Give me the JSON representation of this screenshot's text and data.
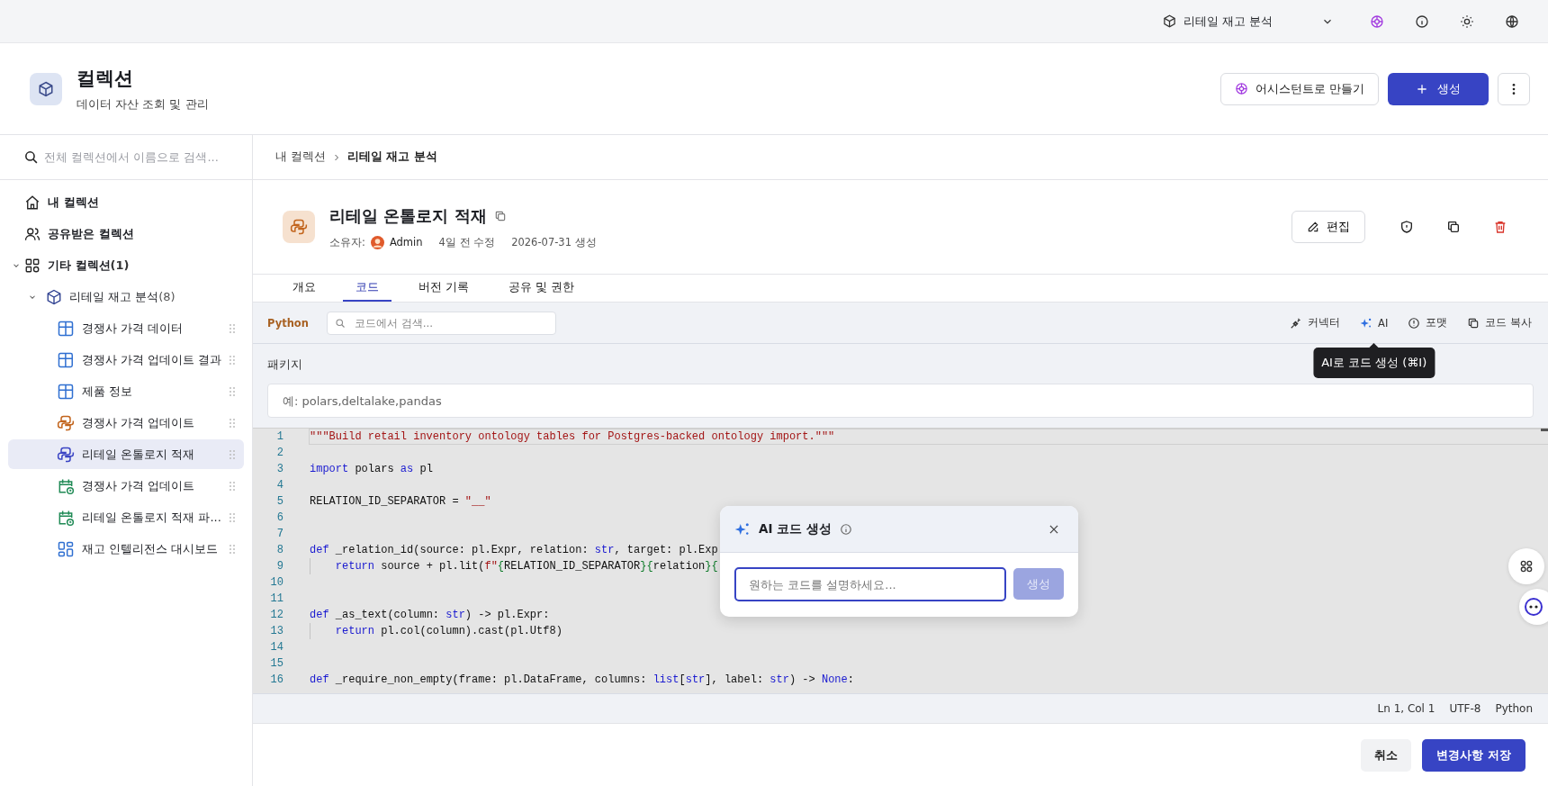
{
  "top_bar": {
    "project": "리테일 재고 분석"
  },
  "header": {
    "title": "컬렉션",
    "subtitle": "데이터 자산 조회 및 관리",
    "assistant_button": "어시스턴트로 만들기",
    "create_button": "생성"
  },
  "sidebar": {
    "search_placeholder": "전체 컬렉션에서 이름으로 검색...",
    "items": [
      {
        "label": "내 컬렉션",
        "kind": "home",
        "selected": false
      },
      {
        "label": "공유받은 컬렉션",
        "kind": "shared",
        "selected": false
      },
      {
        "label": "기타 컬렉션",
        "count": "(1)",
        "kind": "group",
        "selected": false,
        "expanded": true,
        "children": [
          {
            "label": "리테일 재고 분석",
            "count": "(8)",
            "kind": "collection",
            "selected": false,
            "expanded": true,
            "children": [
              {
                "label": "경쟁사 가격 데이터",
                "kind": "table",
                "selected": false
              },
              {
                "label": "경쟁사 가격 업데이트 결과",
                "kind": "table",
                "selected": false
              },
              {
                "label": "제품 정보",
                "kind": "table",
                "selected": false
              },
              {
                "label": "경쟁사 가격 업데이트",
                "kind": "python",
                "selected": false
              },
              {
                "label": "리테일 온톨로지 적재",
                "kind": "python",
                "selected": true
              },
              {
                "label": "경쟁사 가격 업데이트",
                "kind": "schedule",
                "selected": false
              },
              {
                "label": "리테일 온톨로지 적재 파...",
                "kind": "schedule",
                "selected": false
              },
              {
                "label": "재고 인텔리전스 대시보드",
                "kind": "dashboard",
                "selected": false
              }
            ]
          }
        ]
      }
    ]
  },
  "breadcrumb": [
    "내 컬렉션",
    "리테일 재고 분석"
  ],
  "detail": {
    "title": "리테일 온톨로지 적재",
    "owner_label": "소유자:",
    "owner": "Admin",
    "modified": "4일 전 수정",
    "created": "2026-07-31 생성",
    "edit_button": "편집"
  },
  "tabs": [
    {
      "label": "개요",
      "selected": false
    },
    {
      "label": "코드",
      "selected": true
    },
    {
      "label": "버전 기록",
      "selected": false
    },
    {
      "label": "공유 및 권한",
      "selected": false
    }
  ],
  "toolbar": {
    "language": "Python",
    "search_placeholder": "코드에서 검색...",
    "actions": [
      {
        "label": "커넥터",
        "kind": "connector"
      },
      {
        "label": "AI",
        "kind": "ai"
      },
      {
        "label": "포맷",
        "kind": "format"
      },
      {
        "label": "코드 복사",
        "kind": "copy"
      }
    ],
    "tooltip": "AI로 코드 생성 (⌘I)"
  },
  "packages": {
    "label": "패키지",
    "placeholder": "예: polars,deltalake,pandas"
  },
  "editor": {
    "lines": [
      {
        "number": "1",
        "current": true,
        "tokens": [
          {
            "text": "\"\"\"Build retail inventory ontology tables for Postgres-backed ontology import.\"\"\"",
            "kind": "string"
          }
        ]
      },
      {
        "number": "2",
        "current": false
      },
      {
        "number": "3",
        "current": false,
        "tokens": [
          {
            "text": "import",
            "kind": "keyword"
          },
          {
            "text": " polars ",
            "kind": "plain"
          },
          {
            "text": "as",
            "kind": "keyword"
          },
          {
            "text": " pl",
            "kind": "plain"
          }
        ]
      },
      {
        "number": "4",
        "current": false
      },
      {
        "number": "5",
        "current": false,
        "tokens": [
          {
            "text": "RELATION_ID_SEPARATOR = ",
            "kind": "plain"
          },
          {
            "text": "\"__\"",
            "kind": "string"
          }
        ]
      },
      {
        "number": "6",
        "current": false
      },
      {
        "number": "7",
        "current": false
      },
      {
        "number": "8",
        "current": false,
        "tokens": [
          {
            "text": "def",
            "kind": "keyword"
          },
          {
            "text": " _relation_id(source: pl.Expr, relation: ",
            "kind": "plain"
          },
          {
            "text": "str",
            "kind": "keyword"
          },
          {
            "text": ", target: pl.Exp",
            "kind": "plain"
          }
        ]
      },
      {
        "number": "9",
        "current": false,
        "indented": true,
        "tokens": [
          {
            "text": "return",
            "kind": "keyword"
          },
          {
            "text": " source + pl.lit(",
            "kind": "plain"
          },
          {
            "text": "f\"",
            "kind": "string"
          },
          {
            "text": "{",
            "kind": "interp"
          },
          {
            "text": "RELATION_ID_SEPARATOR",
            "kind": "plain"
          },
          {
            "text": "}{",
            "kind": "interp"
          },
          {
            "text": "relation",
            "kind": "plain"
          },
          {
            "text": "}{",
            "kind": "interp"
          }
        ]
      },
      {
        "number": "10",
        "current": false
      },
      {
        "number": "11",
        "current": false
      },
      {
        "number": "12",
        "current": false,
        "tokens": [
          {
            "text": "def",
            "kind": "keyword"
          },
          {
            "text": " _as_text(column: ",
            "kind": "plain"
          },
          {
            "text": "str",
            "kind": "keyword"
          },
          {
            "text": ") -> pl.Expr:",
            "kind": "plain"
          }
        ]
      },
      {
        "number": "13",
        "current": false,
        "indented": true,
        "tokens": [
          {
            "text": "return",
            "kind": "keyword"
          },
          {
            "text": " pl.col(column).cast(pl.Utf8)",
            "kind": "plain"
          }
        ]
      },
      {
        "number": "14",
        "current": false
      },
      {
        "number": "15",
        "current": false
      },
      {
        "number": "16",
        "current": false,
        "tokens": [
          {
            "text": "def",
            "kind": "keyword"
          },
          {
            "text": " _require_non_empty(frame: pl.DataFrame, columns: ",
            "kind": "plain"
          },
          {
            "text": "list",
            "kind": "keyword"
          },
          {
            "text": "[",
            "kind": "plain"
          },
          {
            "text": "str",
            "kind": "keyword"
          },
          {
            "text": "], label: ",
            "kind": "plain"
          },
          {
            "text": "str",
            "kind": "keyword"
          },
          {
            "text": ") -> ",
            "kind": "plain"
          },
          {
            "text": "None",
            "kind": "keyword"
          },
          {
            "text": ":",
            "kind": "plain"
          }
        ]
      }
    ]
  },
  "status_bar": [
    "Ln 1, Col 1",
    "UTF-8",
    "Python"
  ],
  "footer": {
    "cancel_button": "취소",
    "save_button": "변경사항 저장"
  },
  "ai_popup": {
    "title": "AI 코드 생성",
    "placeholder": "원하는 코드를 설명하세요...",
    "button": "생성",
    "button_disabled": true
  }
}
